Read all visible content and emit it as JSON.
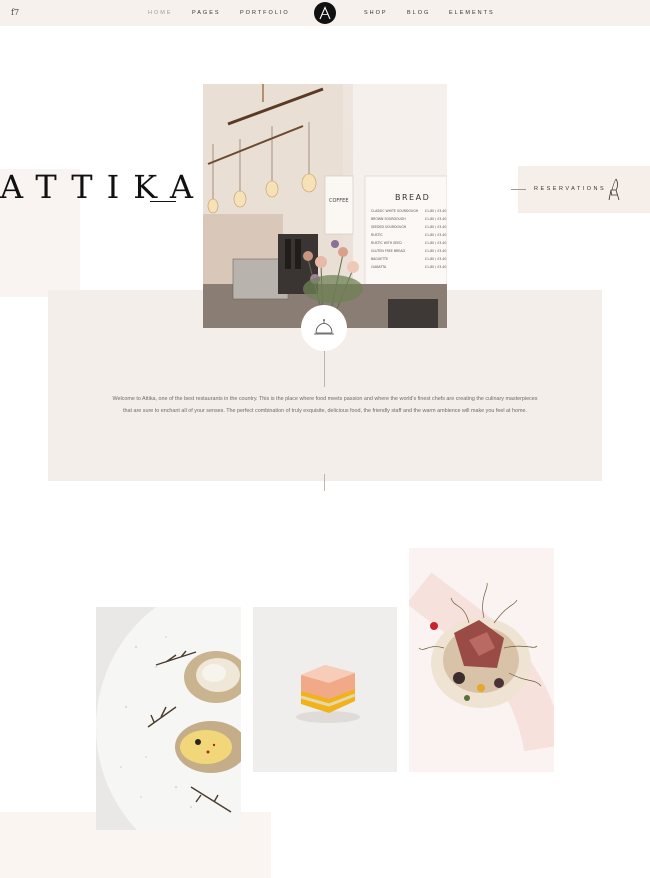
{
  "header": {
    "social_icon_label": "f7",
    "logo_letter": "A",
    "nav": [
      {
        "label": "HOME",
        "active": true
      },
      {
        "label": "PAGES"
      },
      {
        "label": "PORTFOLIO"
      },
      {
        "label": "SHOP"
      },
      {
        "label": "BLOG"
      },
      {
        "label": "ELEMENTS"
      }
    ]
  },
  "brand": {
    "wordmark": "ATTIKA"
  },
  "reservations": {
    "label": "RESERVATIONS",
    "icon": "chair-icon"
  },
  "hero": {
    "icon": "cloche-icon",
    "menu_heading": "BREAD",
    "coffee_sign": "COFFEE",
    "menu_items": [
      "CLASSIC WHITE SOURDOUGH",
      "BROWN SOURDOUGH",
      "SEEDED SOURDOUGH",
      "RUSTIC",
      "RUSTIC WITH SEED",
      "GLUTEN FREE BREAD",
      "BAGUETTE",
      "CIABATTA"
    ],
    "menu_prices": [
      "£1.80 / £3.40",
      "£1.80 / £3.40",
      "£1.80 / £3.40",
      "£1.80 / £3.40",
      "£1.80 / £3.40",
      "£1.80 / £3.40",
      "£1.80 / £3.40",
      "£1.80 / £3.40"
    ]
  },
  "intro": {
    "text": "Welcome to Attika, one of the best restaurants in the country. This is the place where food meets passion and where the world's finest chefs are creating the culinary masterpieces that are sure to enchant all of your senses. The perfect combination of truly exquisite, delicious food, the friendly staff and the warm ambience will make you feel at home."
  },
  "colors": {
    "topbar": "#f6f1ed",
    "beige": "#f4eeea",
    "accent_dark": "#111111"
  }
}
